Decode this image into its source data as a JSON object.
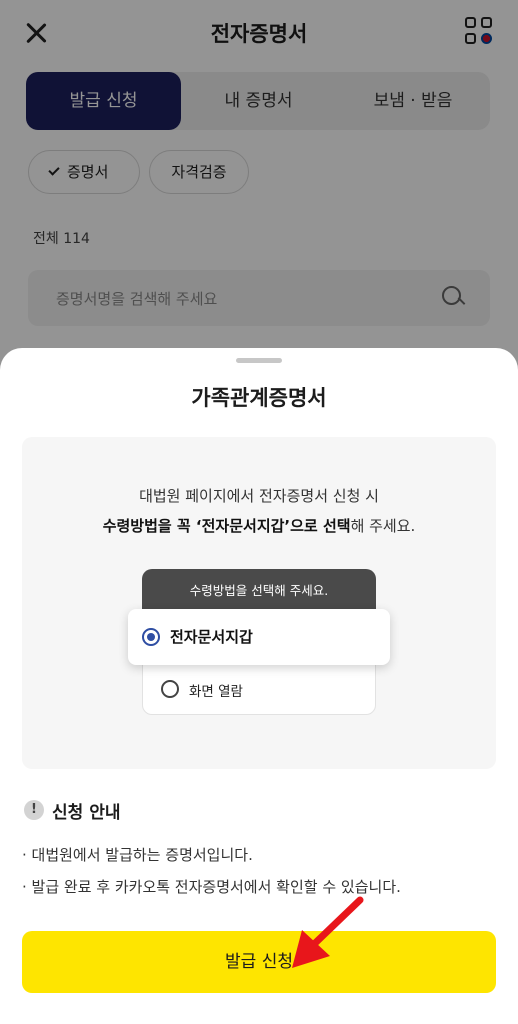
{
  "header": {
    "title": "전자증명서"
  },
  "tabs": [
    {
      "label": "발급 신청",
      "active": true
    },
    {
      "label": "내 증명서",
      "active": false
    },
    {
      "label": "보냄 · 받음",
      "active": false
    }
  ],
  "filters": [
    {
      "label": "증명서",
      "selected": true
    },
    {
      "label": "자격검증",
      "selected": false
    }
  ],
  "list": {
    "count_label": "전체 114"
  },
  "search": {
    "placeholder": "증명서명을 검색해 주세요"
  },
  "sheet": {
    "title": "가족관계증명서",
    "guide": {
      "line1": "대법원 페이지에서 전자증명서 신청 시",
      "line2_bold_a": "수령방법을 꼭 ‘전자문서지갑’으로 선택",
      "line2_rest": "해 주세요.",
      "mock_header": "수령방법을 선택해 주세요.",
      "option_selected": "전자문서지갑",
      "option_other": "화면 열람"
    },
    "notice": {
      "icon": "!",
      "title": "신청 안내",
      "items": [
        "· 대법원에서 발급하는 증명서입니다.",
        "· 발급 완료 후 카카오톡 전자증명서에서 확인할 수 있습니다."
      ]
    },
    "cta_label": "발급 신청"
  },
  "colors": {
    "active_tab": "#1d1f5e",
    "cta": "#fee500",
    "radio": "#2f4ea3",
    "arrow": "#e8161b"
  }
}
